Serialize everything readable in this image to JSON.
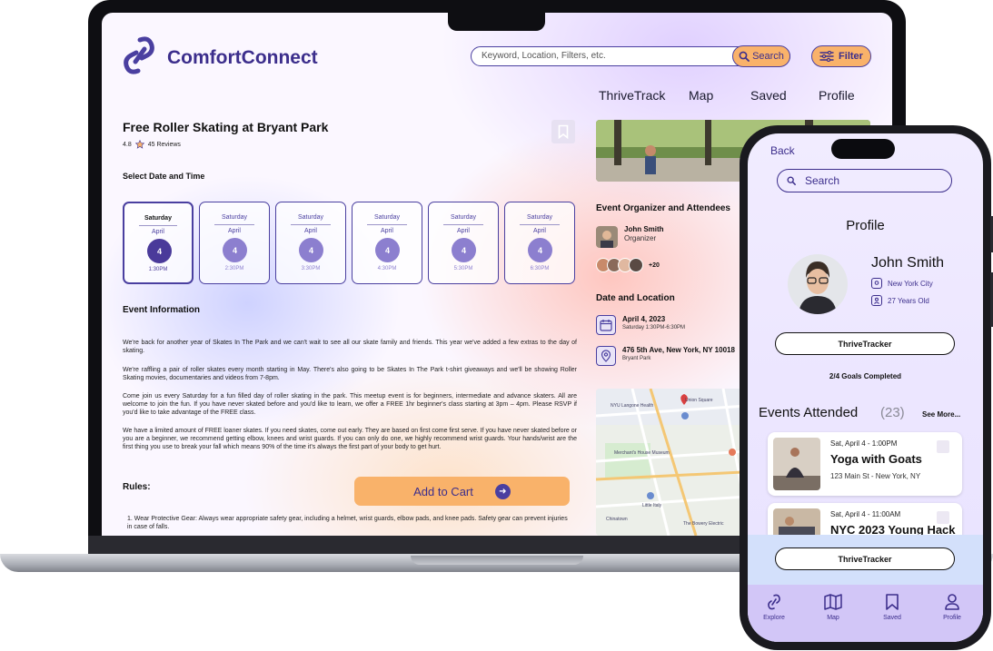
{
  "laptop": {
    "brand": "ComfortConnect",
    "search": {
      "placeholder": "Keyword, Location, Filters, etc.",
      "button": "Search"
    },
    "filter_label": "Filter",
    "nav": [
      "ThriveTrack",
      "Map",
      "Saved",
      "Profile"
    ],
    "event": {
      "title": "Free Roller Skating at Bryant Park",
      "rating": "4.8",
      "reviews": "45 Reviews",
      "select_label": "Select Date and Time",
      "dates": [
        {
          "day": "Saturday",
          "month": "April",
          "date": "4",
          "time": "1:30PM",
          "selected": true
        },
        {
          "day": "Saturday",
          "month": "April",
          "date": "4",
          "time": "2:30PM",
          "selected": false
        },
        {
          "day": "Saturday",
          "month": "April",
          "date": "4",
          "time": "3:30PM",
          "selected": false
        },
        {
          "day": "Saturday",
          "month": "April",
          "date": "4",
          "time": "4:30PM",
          "selected": false
        },
        {
          "day": "Saturday",
          "month": "April",
          "date": "4",
          "time": "5:30PM",
          "selected": false
        },
        {
          "day": "Saturday",
          "month": "April",
          "date": "4",
          "time": "6:30PM",
          "selected": false
        }
      ],
      "info_heading": "Event Information",
      "paragraphs": [
        "We're back for another year of Skates In The Park and we can't wait to see all our skate family and friends. This year we've added a few extras to the day of skating.",
        "We're raffling a pair of roller skates every month starting in May. There's also going to be Skates In The Park t-shirt giveaways and we'll be showing Roller Skating movies, documentaries and videos from 7-8pm.",
        "Come join us every Saturday for a fun filled day of roller skating in the park. This meetup event is for beginners, intermediate and advance skaters. All are welcome to join the fun. If you have never skated before and you'd like to learn, we offer a FREE 1hr beginner's class starting at 3pm – 4pm. Please RSVP if you'd like to take advantage of the FREE class.",
        "We have a limited amount of FREE loaner skates. If you need skates, come out early. They are based on first come first serve. If you have never skated before or you are a beginner, we recommend getting elbow, knees and wrist guards. If you can only do one, we highly recommend wrist guards. Your hands/wrist are the first thing you use to break your fall which means 90% of the time it's always the first part of your body to get hurt."
      ],
      "rules_heading": "Rules:",
      "rule_1": "1. Wear Protective Gear: Always wear appropriate safety gear, including a helmet, wrist guards, elbow pads, and knee pads. Safety gear can prevent injuries in case of falls.",
      "cart_label": "Add to Cart"
    },
    "sidebar": {
      "organizer_heading": "Event Organizer and Attendees",
      "organizer_name": "John Smith",
      "organizer_role": "Organizer",
      "attendee_count": "+20",
      "date_loc_heading": "Date and Location",
      "date_main": "April 4, 2023",
      "date_sub": "Saturday 1:30PM-6:30PM",
      "address_main": "476 5th Ave, New York, NY 10018",
      "address_sub": "Bryant Park"
    },
    "map_labels": [
      "Merchant's House Museum",
      "Union Square",
      "NYU Langone Health",
      "Little Italy",
      "Chinatown",
      "The Bowery Electric"
    ]
  },
  "phone": {
    "back": "Back",
    "search": "Search",
    "title": "Profile",
    "name": "John Smith",
    "city": "New York City",
    "age": "27 Years Old",
    "tracker_label": "ThriveTracker",
    "goals": "2/4 Goals Completed",
    "events_heading": "Events Attended",
    "events_count": "(23)",
    "see_more": "See More...",
    "events": [
      {
        "date": "Sat, April 4 - 1:00PM",
        "name": "Yoga with Goats",
        "address": "123 Main St - New York, NY"
      },
      {
        "date": "Sat, April 4 - 11:00AM",
        "name": "NYC 2023 Young Hack",
        "address": ""
      }
    ],
    "tabs": [
      {
        "label": "Explore",
        "icon": "explore-icon"
      },
      {
        "label": "Map",
        "icon": "map-icon"
      },
      {
        "label": "Saved",
        "icon": "bookmark-icon"
      },
      {
        "label": "Profile",
        "icon": "profile-icon"
      }
    ]
  },
  "colors": {
    "primary": "#4a3fa0",
    "accent": "#f9b26a",
    "text": "#111111"
  }
}
